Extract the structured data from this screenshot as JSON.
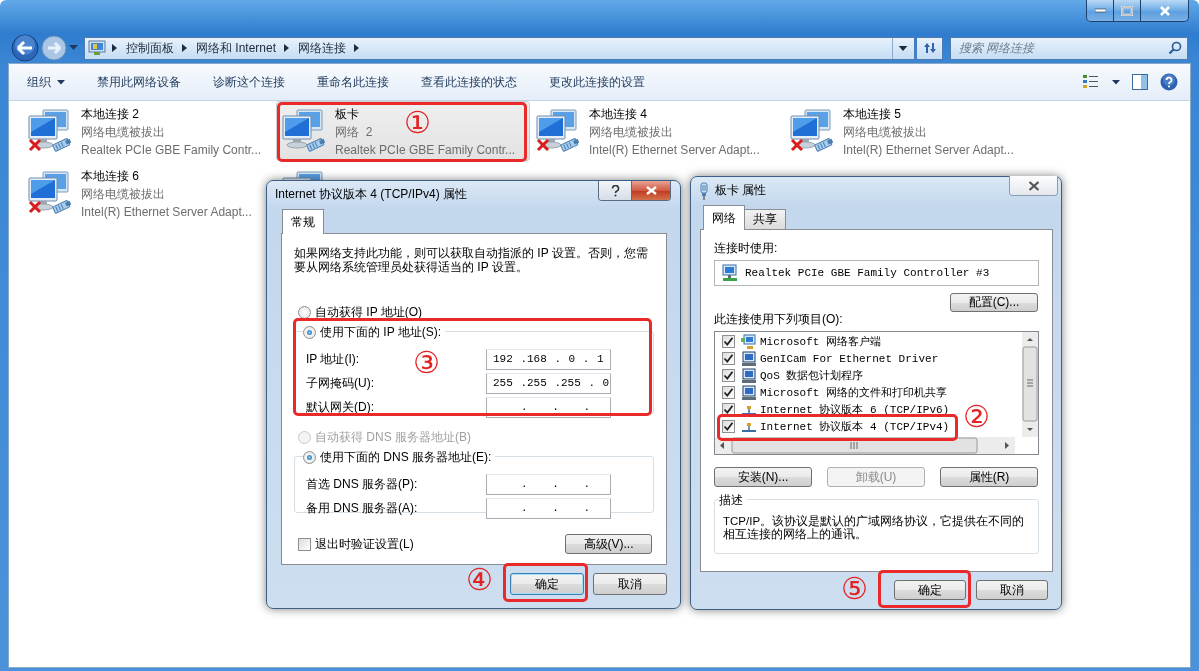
{
  "explorer": {
    "breadcrumb": [
      "控制面板",
      "网络和 Internet",
      "网络连接"
    ],
    "search": {
      "placeholder": "搜索 网络连接"
    },
    "toolbar": [
      {
        "label": "组织",
        "menu": true
      },
      {
        "label": "禁用此网络设备",
        "menu": false
      },
      {
        "label": "诊断这个连接",
        "menu": false
      },
      {
        "label": "重命名此连接",
        "menu": false
      },
      {
        "label": "查看此连接的状态",
        "menu": false
      },
      {
        "label": "更改此连接的设置",
        "menu": false
      }
    ]
  },
  "connections": [
    {
      "name": "本地连接 2",
      "status": "网络电缆被拔出",
      "device": "Realtek PCIe GBE Family Contr...",
      "disconnected": true,
      "selected": false
    },
    {
      "name": "板卡",
      "status": "网络  2",
      "device": "Realtek PCIe GBE Family Contr...",
      "disconnected": false,
      "selected": true
    },
    {
      "name": "本地连接 4",
      "status": "网络电缆被拔出",
      "device": "Intel(R) Ethernet Server Adapt...",
      "disconnected": true,
      "selected": false
    },
    {
      "name": "本地连接 5",
      "status": "网络电缆被拔出",
      "device": "Intel(R) Ethernet Server Adapt...",
      "disconnected": true,
      "selected": false
    },
    {
      "name": "本地连接 6",
      "status": "网络电缆被拔出",
      "device": "Intel(R) Ethernet Server Adapt...",
      "disconnected": true,
      "selected": false
    },
    {
      "selected": false
    }
  ],
  "ipv4_dialog": {
    "title": "Internet 协议版本 4 (TCP/IPv4) 属性",
    "tabs": [
      {
        "label": "常规",
        "selected": true
      }
    ],
    "intro": "如果网络支持此功能，则可以获取自动指派的 IP 设置。否则，您需要从网络系统管理员处获得适当的 IP 设置。",
    "ip_mode": [
      {
        "label": "自动获得 IP 地址(O)",
        "selected": false,
        "disabled": false
      },
      {
        "label": "使用下面的 IP 地址(S):",
        "selected": true,
        "disabled": false
      }
    ],
    "ip_fields": [
      {
        "label": "IP 地址(I):",
        "value": "192 .168 . 0 . 1"
      },
      {
        "label": "子网掩码(U):",
        "value": "255 .255 .255 . 0"
      },
      {
        "label": "默认网关(D):",
        "value": ". . ."
      }
    ],
    "dns_mode": [
      {
        "label": "自动获得 DNS 服务器地址(B)",
        "selected": false,
        "disabled": true
      },
      {
        "label": "使用下面的 DNS 服务器地址(E):",
        "selected": true,
        "disabled": false
      }
    ],
    "dns_fields": [
      {
        "label": "首选 DNS 服务器(P):",
        "value": ". . ."
      },
      {
        "label": "备用 DNS 服务器(A):",
        "value": ". . ."
      }
    ],
    "validate": {
      "label": "退出时验证设置(L)",
      "checked": false
    },
    "advanced_button": "高级(V)...",
    "buttons": [
      {
        "label": "确定",
        "default": true
      },
      {
        "label": "取消",
        "default": false
      }
    ]
  },
  "adapter_dialog": {
    "title": "板卡 属性",
    "tabs": [
      {
        "label": "网络",
        "selected": true
      },
      {
        "label": "共享",
        "selected": false
      }
    ],
    "connect_using_label": "连接时使用:",
    "adapter": "Realtek PCIe GBE Family Controller #3",
    "configure_button": "配置(C)...",
    "items_label": "此连接使用下列项目(O):",
    "items": [
      {
        "kind": "client",
        "label": "Microsoft 网络客户端",
        "checked": true
      },
      {
        "kind": "service",
        "label": "GenICam For Ethernet Driver",
        "checked": true
      },
      {
        "kind": "service",
        "label": "QoS 数据包计划程序",
        "checked": true
      },
      {
        "kind": "service",
        "label": "Microsoft 网络的文件和打印机共享",
        "checked": true
      },
      {
        "kind": "protocol",
        "label": "Internet 协议版本 6 (TCP/IPv6)",
        "checked": true
      },
      {
        "kind": "protocol",
        "label": "Internet 协议版本 4 (TCP/IPv4)",
        "checked": true
      }
    ],
    "item_buttons": [
      {
        "label": "安装(N)...",
        "disabled": false
      },
      {
        "label": "卸载(U)",
        "disabled": true
      },
      {
        "label": "属性(R)",
        "disabled": false
      }
    ],
    "description": {
      "title": "描述",
      "text": "TCP/IP。该协议是默认的广域网络协议，它提供在不同的相互连接的网络上的通讯。"
    },
    "buttons": [
      {
        "label": "确定",
        "default": false
      },
      {
        "label": "取消",
        "default": false
      }
    ]
  },
  "annotations": [
    {
      "label": "①"
    },
    {
      "label": "②"
    },
    {
      "label": "③"
    },
    {
      "label": "④"
    },
    {
      "label": "⑤"
    }
  ]
}
